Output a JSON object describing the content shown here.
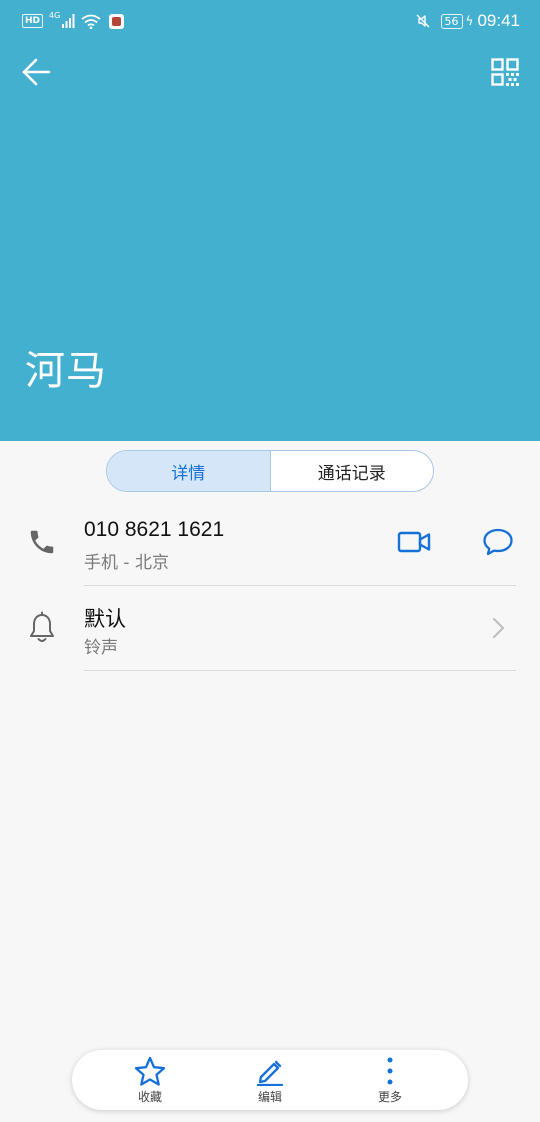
{
  "status_bar": {
    "hd": "HD",
    "network": "4G",
    "battery": "56",
    "time": "09:41"
  },
  "header": {
    "background_color": "#44b0cf",
    "contact_name": "河马",
    "back_icon": "arrow-left-icon",
    "qr_icon": "qr-code-icon"
  },
  "tabs": [
    {
      "label": "详情",
      "active": true
    },
    {
      "label": "通话记录",
      "active": false
    }
  ],
  "phone_entry": {
    "number": "010 8621 1621",
    "subtitle": "手机 - 北京",
    "icon": "phone-icon",
    "actions": [
      "video-call-icon",
      "message-icon"
    ]
  },
  "ringtone_entry": {
    "title": "默认",
    "subtitle": "铃声",
    "icon": "bell-icon"
  },
  "bottom_bar": {
    "items": [
      {
        "label": "收藏",
        "icon": "star-icon"
      },
      {
        "label": "编辑",
        "icon": "pencil-icon"
      },
      {
        "label": "更多",
        "icon": "more-vertical-icon"
      }
    ]
  },
  "accent_color": "#1570d8"
}
